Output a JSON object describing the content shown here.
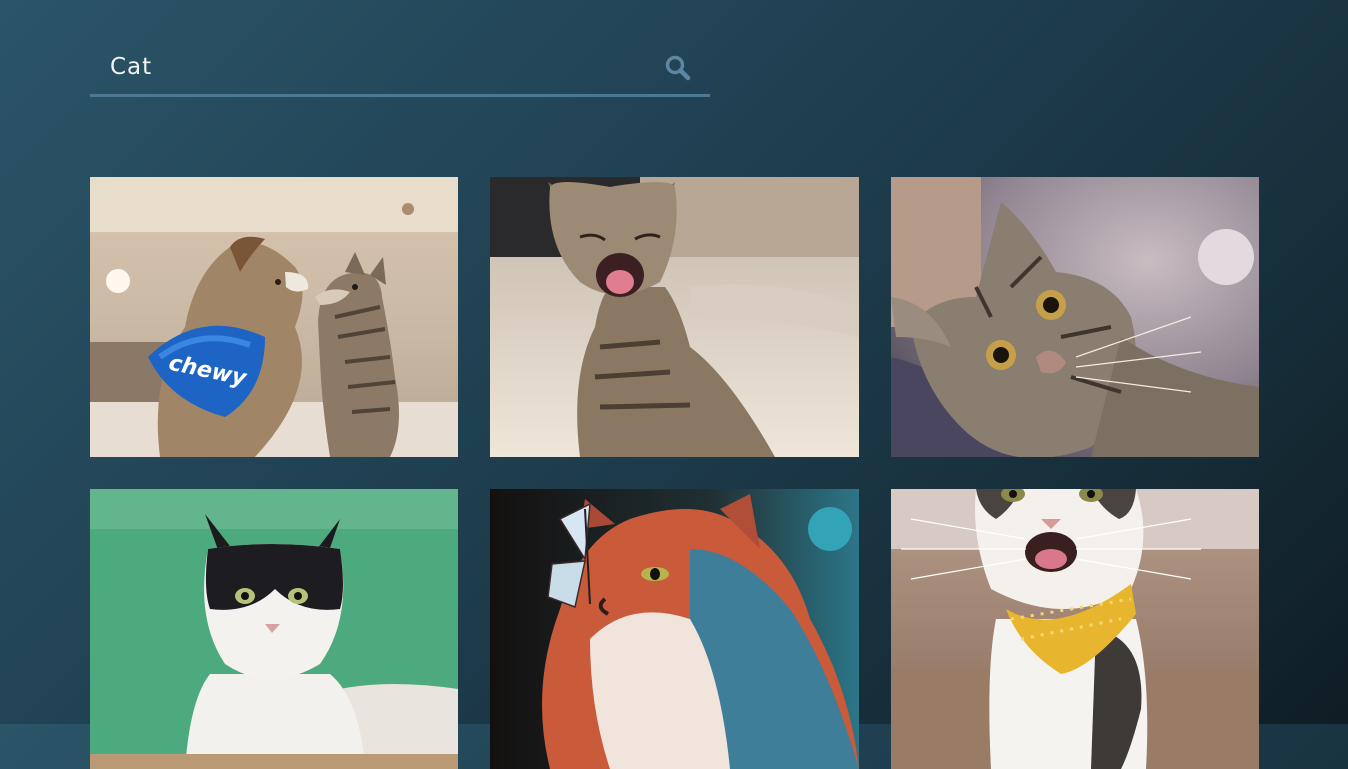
{
  "search": {
    "value": "Cat",
    "icon": "search-icon",
    "underline_color": "#4a7895"
  },
  "gallery": {
    "images": [
      {
        "subject": "dog-and-tabby-cat",
        "bandana_text": "chewy"
      },
      {
        "subject": "yawning-tabby-kitten"
      },
      {
        "subject": "curious-tabby-cat"
      },
      {
        "subject": "black-white-cat-green-wall"
      },
      {
        "subject": "fluffy-cat-with-butterfly"
      },
      {
        "subject": "smiling-cat-yellow-bandana"
      }
    ]
  }
}
